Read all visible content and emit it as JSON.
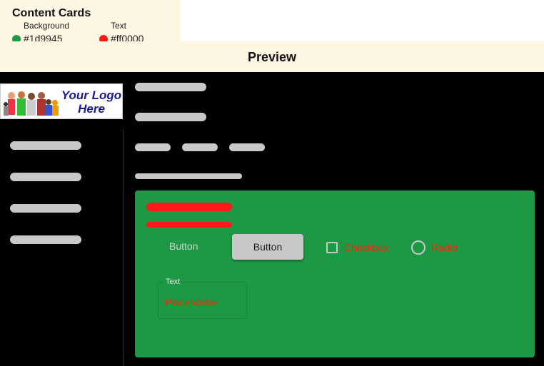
{
  "header": {
    "title": "Content Cards",
    "fields": [
      {
        "label": "Background",
        "value": "#1d9945",
        "swatch": "#1d9945"
      },
      {
        "label": "Text",
        "value": "#ff0000",
        "swatch": "#ff1a1a"
      }
    ]
  },
  "preview": {
    "title": "Preview",
    "logo": {
      "line1": "Your Logo",
      "line2": "Here"
    },
    "card": {
      "text_button": "Button",
      "filled_button": "Button",
      "checkbox_label": "Checkbox",
      "radio_label": "Radio",
      "textfield_label": "Text",
      "textfield_placeholder": "Placeholder"
    }
  },
  "colors": {
    "background": "#1d9945",
    "text": "#ff0000"
  }
}
